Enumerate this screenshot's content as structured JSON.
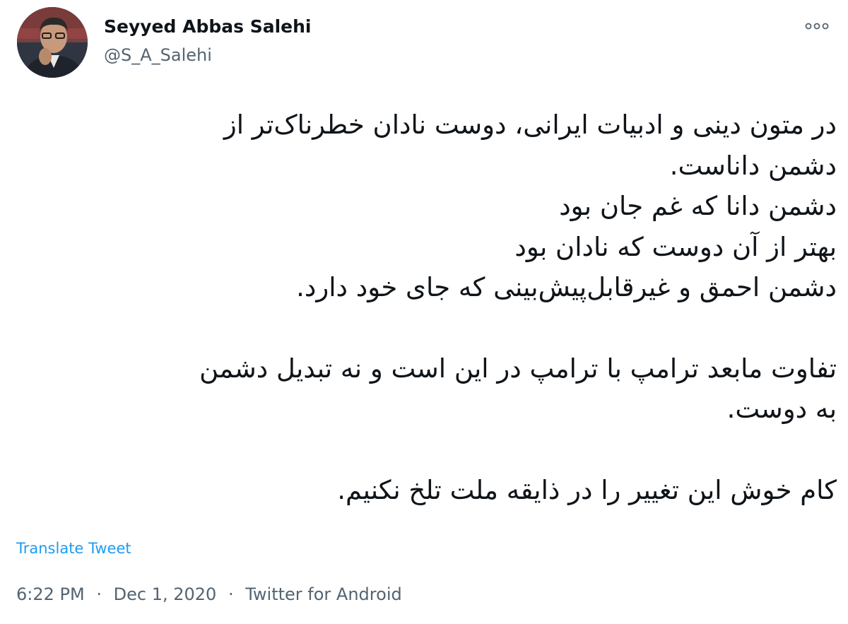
{
  "author": {
    "name": "Seyyed Abbas Salehi",
    "handle": "@S_A_Salehi",
    "avatar_icon": "user-avatar-photo"
  },
  "menu": {
    "icon": "more-options-icon"
  },
  "tweet": {
    "lines": [
      "در متون دینی و ادبیات ایرانی، دوست نادان  خطرناک‌تر از",
      "دشمن داناست.",
      "دشمن دانا که غم جان بود",
      "بهتر از آن دوست که نادان بود",
      "دشمن احمق و غیرقابل‌پیش‌بینی که جای خود دارد.",
      "",
      "تفاوت مابعد ترامپ با  ترامپ در این است و نه تبدیل دشمن",
      "به دوست.",
      "",
      "کام خوش این تغییر را در ذایقه ملت تلخ نکنیم."
    ]
  },
  "translate": {
    "label": "Translate Tweet"
  },
  "meta": {
    "time": "6:22 PM",
    "date": "Dec 1, 2020",
    "source": "Twitter for Android",
    "separator": "·"
  },
  "colors": {
    "text": "#0f1419",
    "secondary": "#536471",
    "link": "#1d9bf0"
  }
}
